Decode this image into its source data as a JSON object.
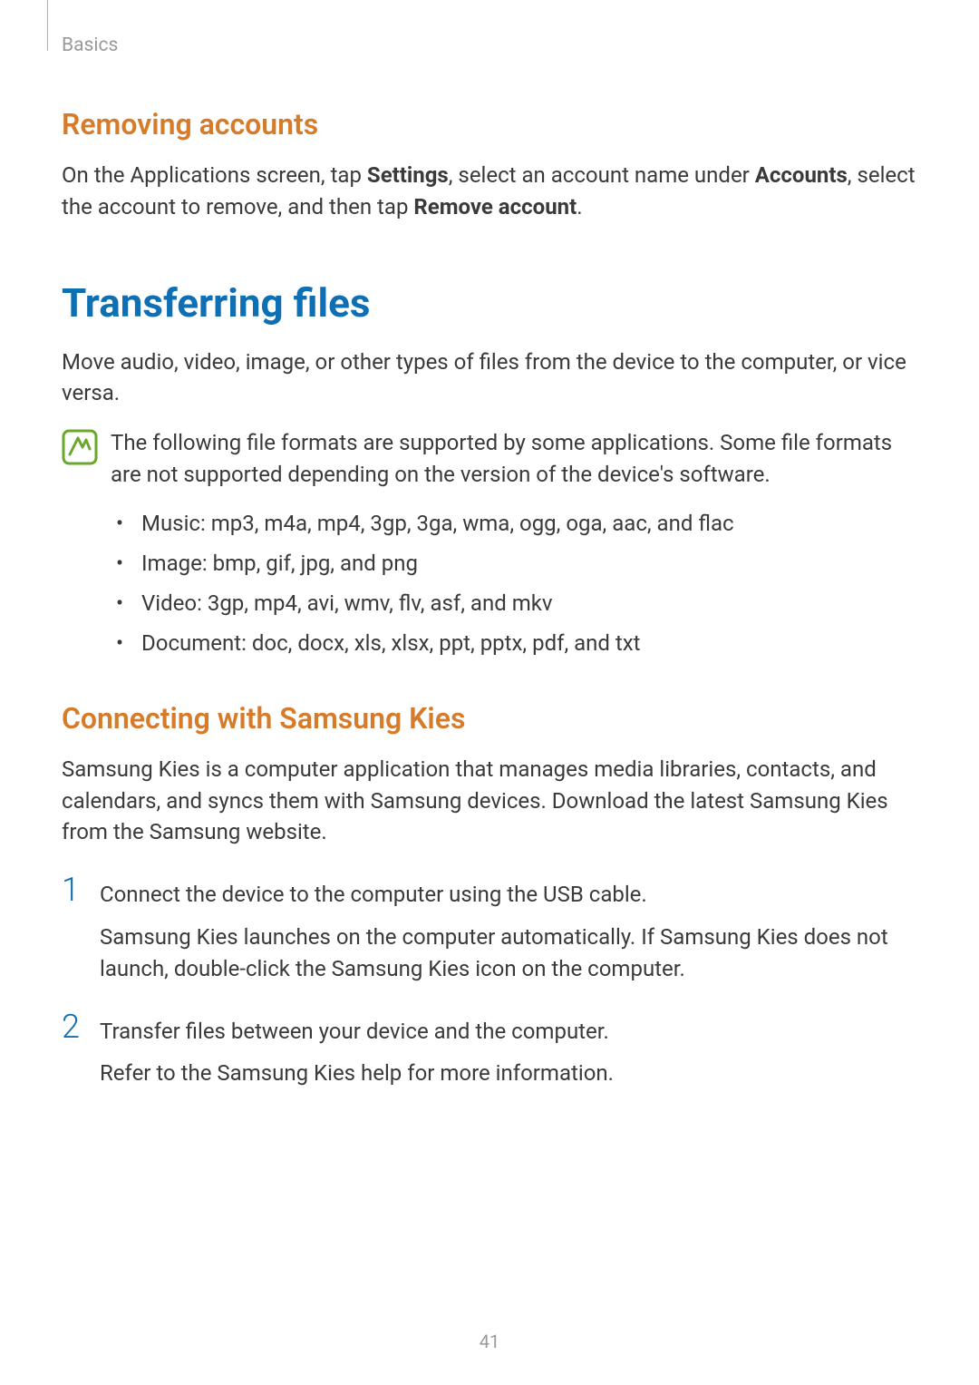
{
  "header": {
    "breadcrumb": "Basics"
  },
  "section1": {
    "title": "Removing accounts",
    "para_pre": "On the Applications screen, tap ",
    "bold1": "Settings",
    "para_mid": ", select an account name under ",
    "bold2": "Accounts",
    "para_mid2": ", select the account to remove, and then tap ",
    "bold3": "Remove account",
    "para_end": "."
  },
  "section2": {
    "title": "Transferring files",
    "intro": "Move audio, video, image, or other types of files from the device to the computer, or vice versa.",
    "note": "The following file formats are supported by some applications. Some file formats are not supported depending on the version of the device's software.",
    "bullets": [
      "Music: mp3, m4a, mp4, 3gp, 3ga, wma, ogg, oga, aac, and flac",
      "Image: bmp, gif, jpg, and png",
      "Video: 3gp, mp4, avi, wmv, flv, asf, and mkv",
      "Document: doc, docx, xls, xlsx, ppt, pptx, pdf, and txt"
    ]
  },
  "section3": {
    "title": "Connecting with Samsung Kies",
    "intro": "Samsung Kies is a computer application that manages media libraries, contacts, and calendars, and syncs them with Samsung devices. Download the latest Samsung Kies from the Samsung website.",
    "steps": [
      {
        "num": "1",
        "main": "Connect the device to the computer using the USB cable.",
        "sub": "Samsung Kies launches on the computer automatically. If Samsung Kies does not launch, double-click the Samsung Kies icon on the computer."
      },
      {
        "num": "2",
        "main": "Transfer files between your device and the computer.",
        "sub": "Refer to the Samsung Kies help for more information."
      }
    ]
  },
  "page_number": "41"
}
